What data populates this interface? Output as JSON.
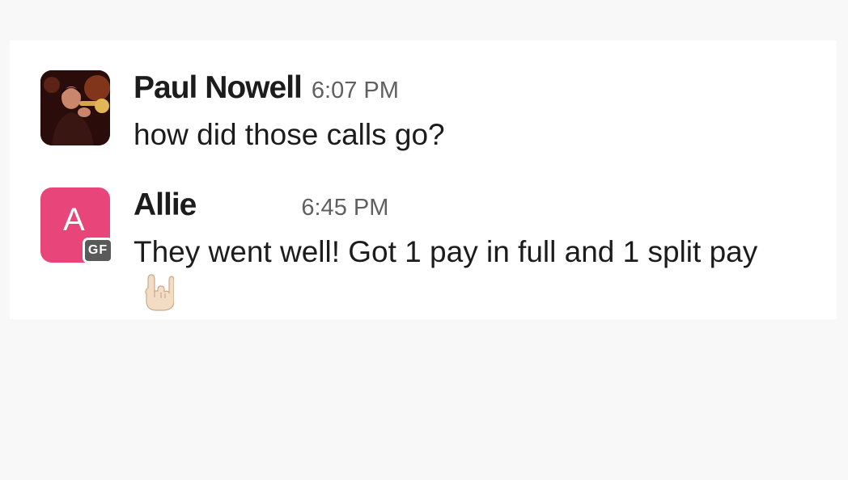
{
  "messages": [
    {
      "sender": "Paul Nowell",
      "time": "6:07 PM",
      "text": "how did those calls go?",
      "avatar": {
        "type": "photo",
        "icon": "user-photo-icon"
      }
    },
    {
      "sender": "Allie",
      "time": "6:45 PM",
      "text": "They went well! Got 1 pay in full and 1 split pay",
      "avatar": {
        "type": "letter",
        "letter": "A",
        "color": "#e8457a",
        "badge": "GF",
        "badge_color": "#5a5a5a"
      },
      "reaction_emoji": "sign-of-the-horns-icon"
    }
  ]
}
